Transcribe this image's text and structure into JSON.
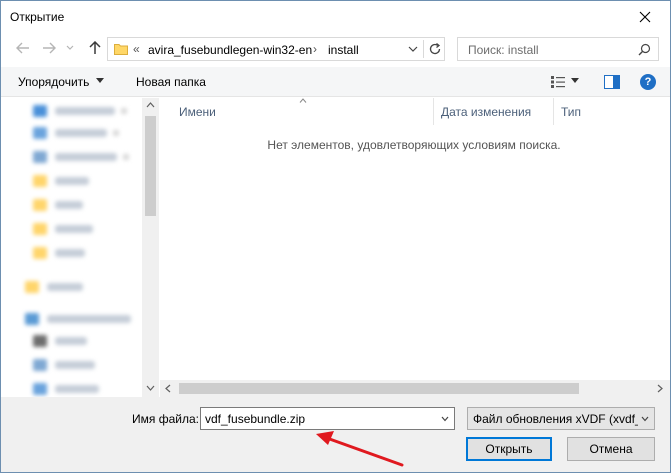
{
  "window": {
    "title": "Открытие"
  },
  "nav": {
    "back_icon": "arrow-left-icon",
    "forward_icon": "arrow-right-icon",
    "recent_icon": "chevron-down-icon",
    "up_icon": "arrow-up-icon"
  },
  "address": {
    "overflow": "«",
    "crumbs": [
      "avira_fusebundlegen-win32-en",
      "install"
    ],
    "separator": "›"
  },
  "search": {
    "placeholder": "Поиск: install"
  },
  "toolbar": {
    "organize_label": "Упорядочить",
    "new_folder_label": "Новая папка"
  },
  "file_list": {
    "columns": [
      "Имени",
      "Дата изменения",
      "Тип"
    ],
    "empty_message": "Нет элементов, удовлетворяющих условиям поиска."
  },
  "footer": {
    "filename_label": "Имя файла:",
    "filename_value": "vdf_fusebundle.zip",
    "filetype_value": "Файл обновления xVDF (xvdf_fusebundle.zip)",
    "open_label": "Открыть",
    "cancel_label": "Отмена"
  },
  "colors": {
    "accent": "#0078d7",
    "annotation_arrow": "#e0191f"
  }
}
